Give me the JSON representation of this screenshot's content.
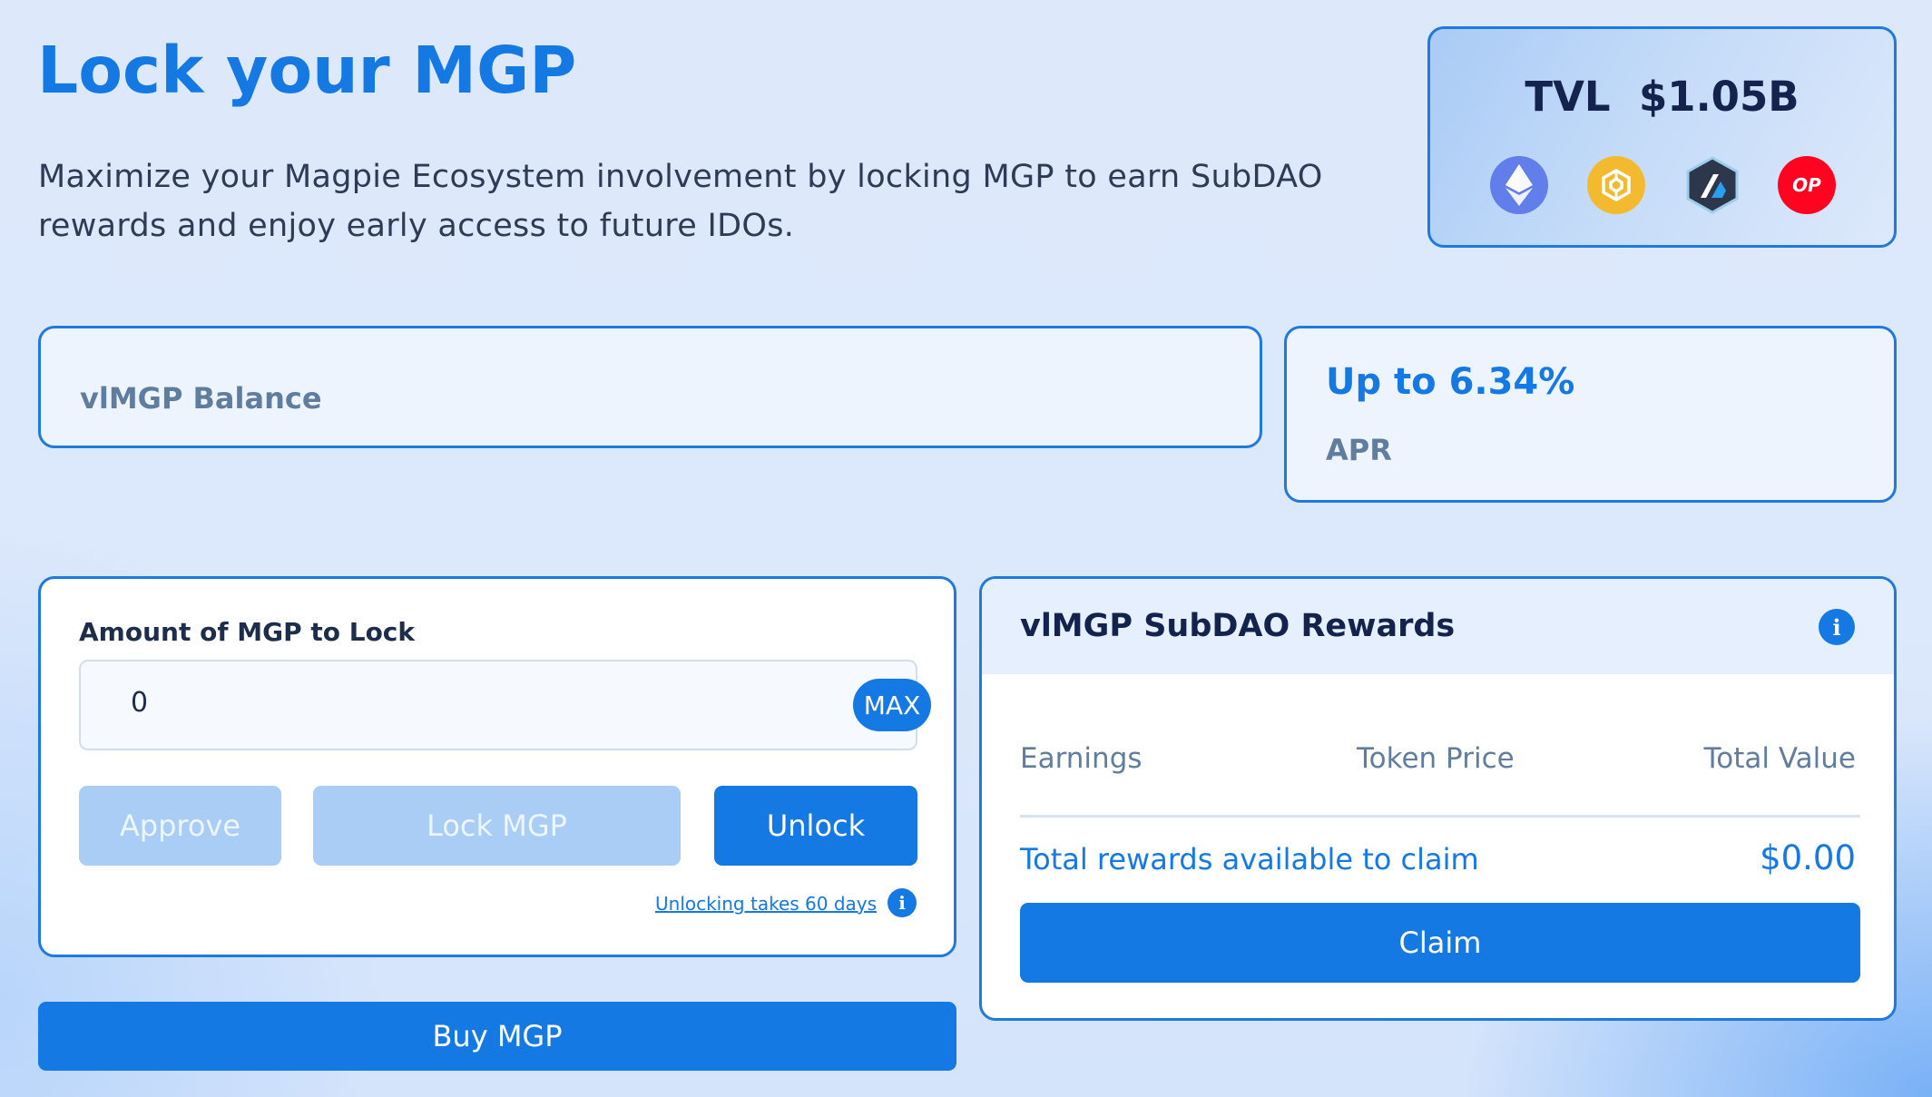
{
  "header": {
    "title": "Lock your MGP",
    "description": "Maximize your Magpie Ecosystem involvement by locking MGP to earn SubDAO rewards and enjoy early access to future IDOs."
  },
  "tvl": {
    "label": "TVL",
    "value": "$1.05B",
    "chains": [
      {
        "name": "ethereum-icon",
        "color": "#627eea"
      },
      {
        "name": "bnb-icon",
        "color": "#f3ba2f"
      },
      {
        "name": "arbitrum-icon",
        "color": "#2d374b"
      },
      {
        "name": "optimism-icon",
        "color": "#ff0420",
        "text": "OP"
      }
    ]
  },
  "balance": {
    "label": "vlMGP Balance"
  },
  "apr": {
    "value": "Up to 6.34%",
    "label": "APR"
  },
  "lock": {
    "amount_label": "Amount of MGP to Lock",
    "input_value": "0",
    "max_label": "MAX",
    "approve_label": "Approve",
    "lock_label": "Lock MGP",
    "unlock_label": "Unlock",
    "unlock_note": "Unlocking takes 60 days",
    "info_icon": "info-icon"
  },
  "buy": {
    "label": "Buy MGP"
  },
  "rewards": {
    "title": "vlMGP SubDAO Rewards",
    "columns": [
      "Earnings",
      "Token Price",
      "Total Value"
    ],
    "total_label": "Total rewards available to claim",
    "total_value": "$0.00",
    "claim_label": "Claim"
  },
  "colors": {
    "accent": "#1479e3",
    "border": "#1f7ae0",
    "disabled": "#a9cdf5"
  }
}
